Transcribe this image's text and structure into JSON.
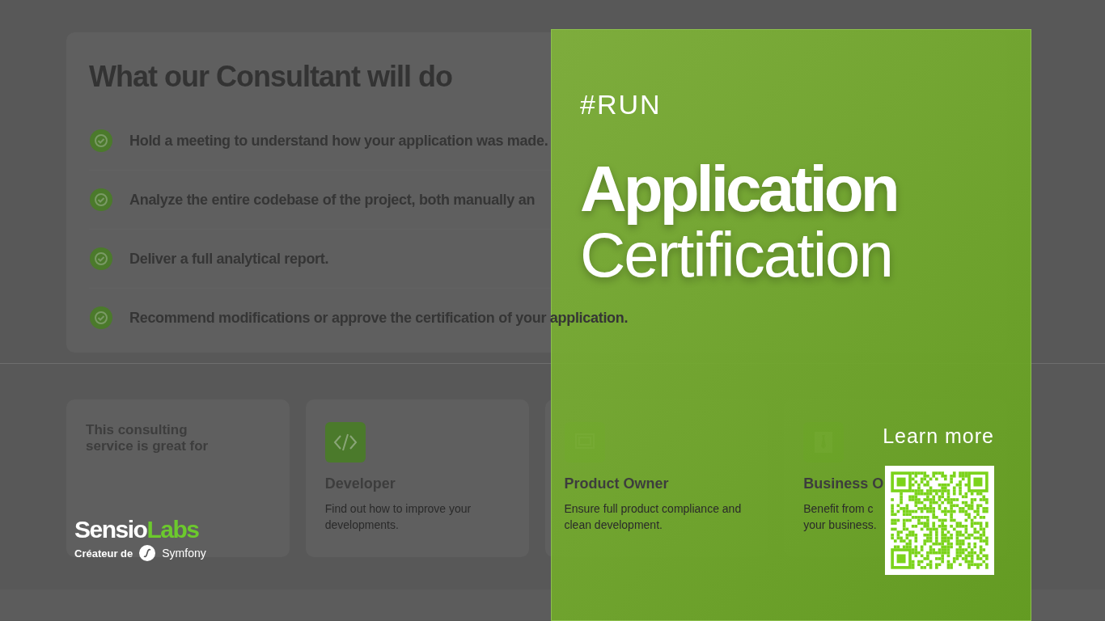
{
  "section": {
    "title": "What our Consultant will do",
    "items": [
      {
        "text": "Hold a meeting to understand how your application was made."
      },
      {
        "text": "Analyze the entire codebase of the project, both manually an"
      },
      {
        "text": "Deliver a full analytical report."
      },
      {
        "text": "Recommend modifications or approve the certification of your application."
      }
    ]
  },
  "audience": {
    "intro": "This consulting service is great for",
    "cards": [
      {
        "kind": "code",
        "title": "Developer",
        "desc_lines": [
          "Find out how to improve your",
          "developments."
        ]
      },
      {
        "kind": "screen",
        "title": "Product Owner",
        "desc_lines": [
          "Ensure full product compliance and",
          "clean development."
        ]
      },
      {
        "kind": "tie",
        "title": "Business O",
        "desc_lines": [
          "Benefit from c",
          "your business."
        ]
      }
    ]
  },
  "brand": {
    "name_a": "Sensio",
    "name_b": "Labs",
    "tagline": "Créateur de",
    "product": "Symfony"
  },
  "promo": {
    "tag": "#RUN",
    "title_bold": "Application",
    "title_light": "Certification",
    "link": "Learn more"
  }
}
